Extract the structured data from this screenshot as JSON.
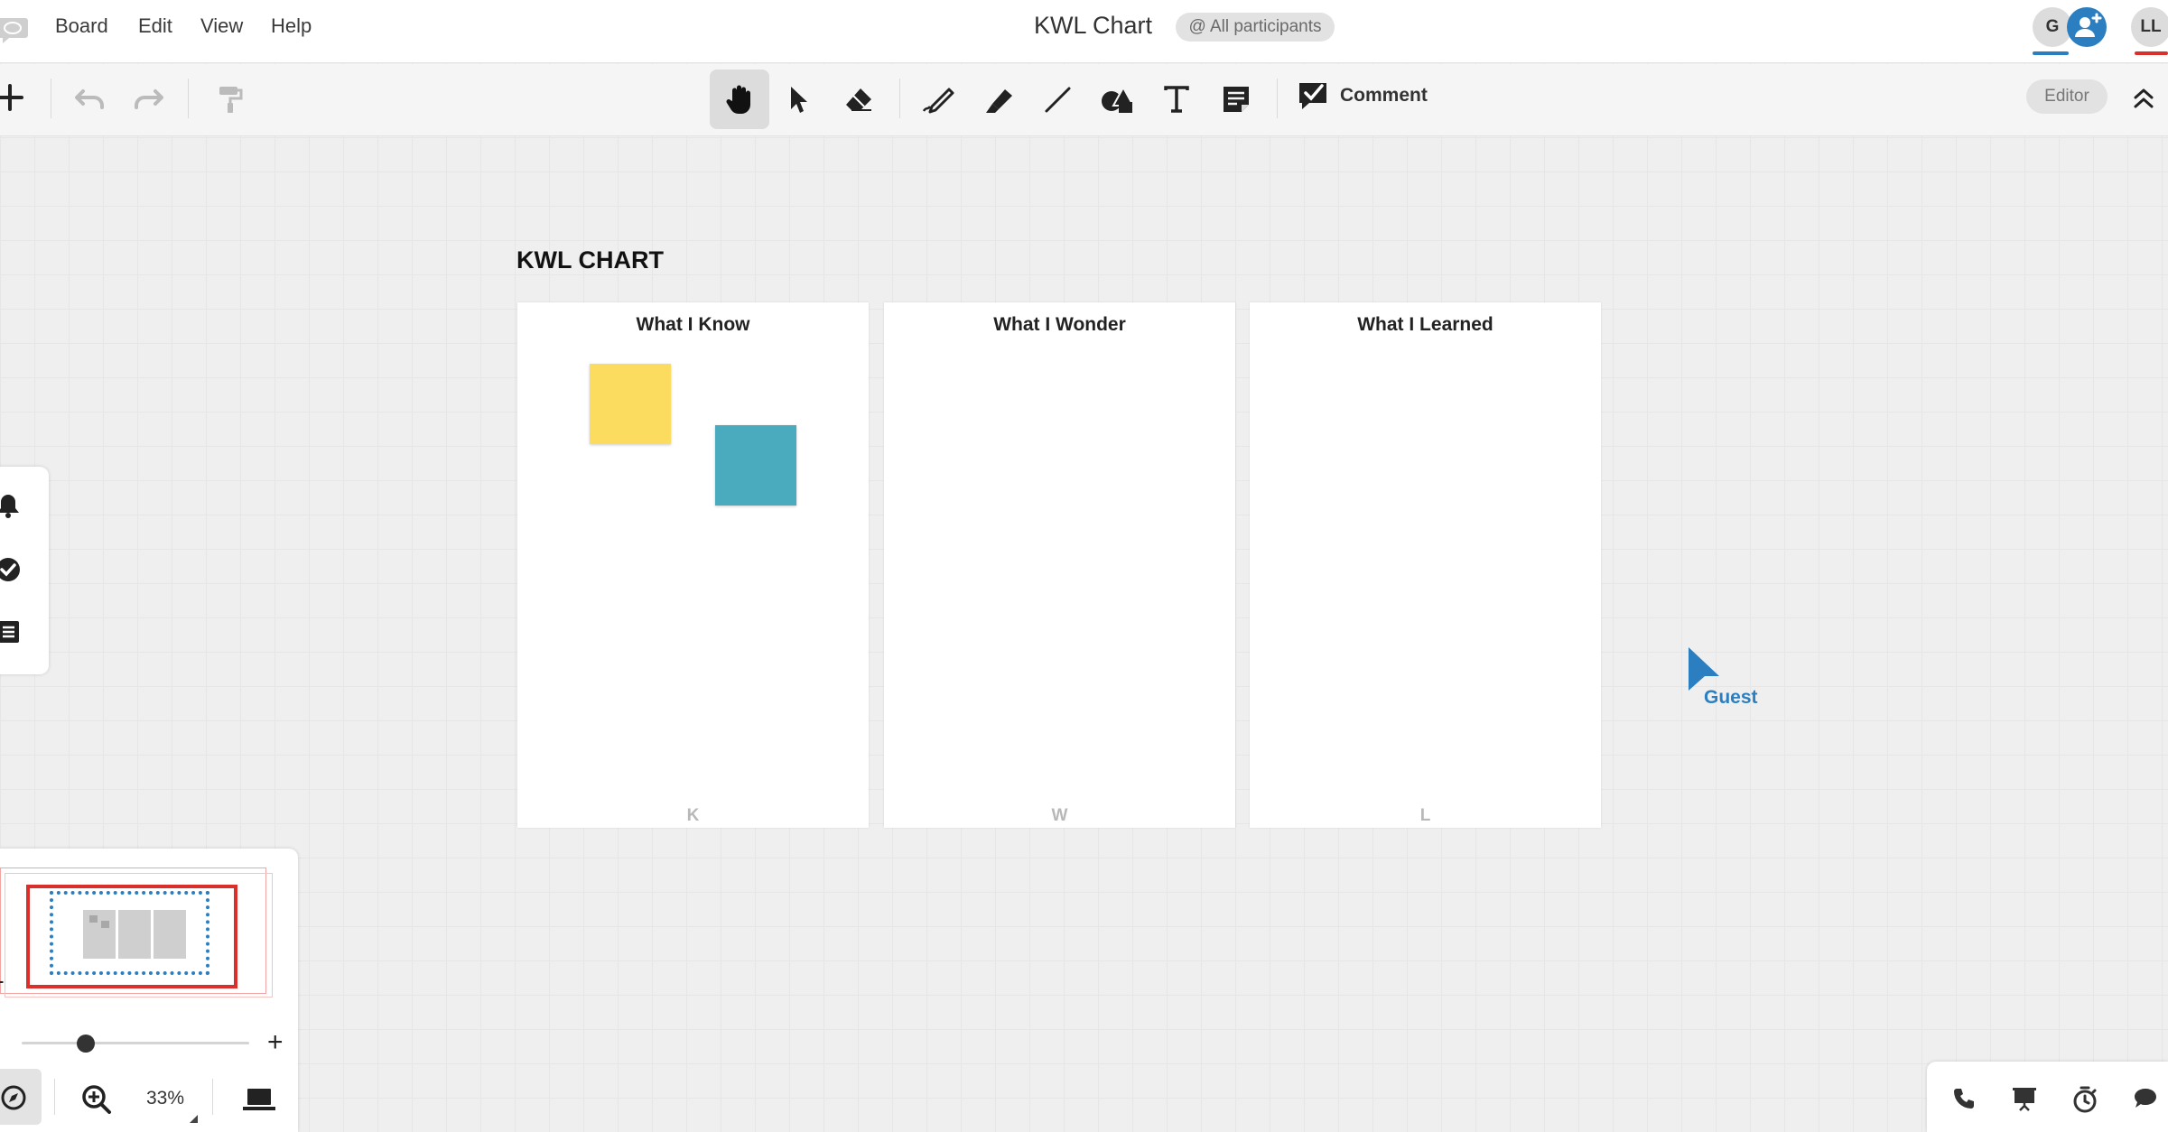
{
  "menu": {
    "items": [
      {
        "label": "Board"
      },
      {
        "label": "Edit"
      },
      {
        "label": "View"
      },
      {
        "label": "Help"
      }
    ]
  },
  "header": {
    "board_title": "KWL Chart",
    "participants_label": "@ All participants",
    "avatars": [
      {
        "initials": "G",
        "underline_color": "#2b7fc1"
      },
      {
        "initials": "LL",
        "underline_color": "#d9302c"
      }
    ]
  },
  "toolbar": {
    "tools": [
      {
        "name": "hand-tool",
        "icon": "hand-icon",
        "active": true
      },
      {
        "name": "select-tool",
        "icon": "pointer-icon"
      },
      {
        "name": "eraser-tool",
        "icon": "eraser-icon"
      },
      {
        "name": "pen-tool",
        "icon": "pen-icon"
      },
      {
        "name": "highlighter-tool",
        "icon": "highlighter-icon"
      },
      {
        "name": "line-tool",
        "icon": "line-icon"
      },
      {
        "name": "shapes-tool",
        "icon": "shapes-icon"
      },
      {
        "name": "text-tool",
        "icon": "text-icon"
      },
      {
        "name": "sticky-note-tool",
        "icon": "sticky-note-icon"
      }
    ],
    "comment_label": "Comment",
    "role_label": "Editor"
  },
  "board": {
    "title": "KWL CHART",
    "columns": [
      {
        "header": "What I Know",
        "letter": "K"
      },
      {
        "header": "What I Wonder",
        "letter": "W"
      },
      {
        "header": "What I Learned",
        "letter": "L"
      }
    ],
    "sticky_notes": [
      {
        "color": "#fbdc5e"
      },
      {
        "color": "#4aaabe"
      }
    ]
  },
  "cursor": {
    "user_label": "Guest",
    "color": "#2b7fc1"
  },
  "side_panel": {
    "icons": [
      "bell-icon",
      "check-circle-icon",
      "list-icon"
    ]
  },
  "minimap": {
    "zoom_slider_fraction": 0.25,
    "zoom_minus": "-",
    "zoom_plus": "+",
    "zoom_level": "33%"
  },
  "bottom_right": {
    "icons": [
      "phone-icon",
      "presentation-icon",
      "timer-icon",
      "chat-icon"
    ]
  },
  "colors": {
    "accent_blue": "#2b7fc1",
    "frame_red": "#d9302c",
    "sticky_yellow": "#fbdc5e",
    "sticky_teal": "#4aaabe"
  }
}
